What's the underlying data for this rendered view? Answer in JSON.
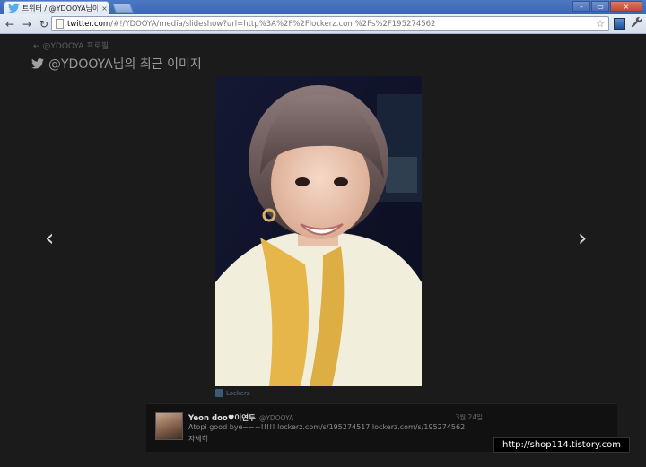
{
  "browser": {
    "tab_title": "트위터 / @YDOOYA님이",
    "tab_close": "×",
    "url_host": "twitter.com",
    "url_rest": "/#!/YDOOYA/media/slideshow?url=http%3A%2F%2Flockerz.com%2Fs%2F195274562",
    "window_buttons": {
      "minimize": "–",
      "maximize": "▭",
      "close": "×"
    },
    "nav": {
      "back": "←",
      "forward": "→",
      "reload": "↻"
    },
    "star": "☆",
    "wrench": "🔧"
  },
  "page": {
    "back_link": "← @YDOOYA 프로필",
    "title": "@YDOOYA님의 최근 이미지",
    "prev_arrow": "‹",
    "next_arrow": "›",
    "source_label": "Lockerz"
  },
  "tweet": {
    "name": "Yeon doo♥이연두",
    "handle": "@YDOOYA",
    "date": "3월 24일",
    "text": "Atopi good bye~~~!!!!! lockerz.com/s/195274517 lockerz.com/s/195274562",
    "detail_link": "자세히"
  },
  "watermark": "http://shop114.tistory.com",
  "colors": {
    "page_bg": "#1b1b1b",
    "twitter_blue": "#55acee"
  },
  "icons": {
    "bird": "twitter-bird-icon",
    "source": "lockerz-icon"
  }
}
